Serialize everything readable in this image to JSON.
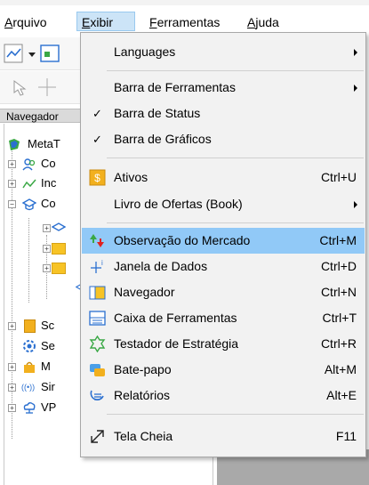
{
  "menubar": {
    "items": [
      {
        "label": "Arquivo",
        "accel": "A",
        "rest": "rquivo"
      },
      {
        "label": "Exibir",
        "accel": "E",
        "rest": "xibir"
      },
      {
        "label": "Ferramentas",
        "accel": "F",
        "rest": "erramentas"
      },
      {
        "label": "Ajuda",
        "accel": "A",
        "rest": "juda"
      }
    ]
  },
  "navigator": {
    "header": "Navegador",
    "root_label": "MetaT",
    "rows": [
      {
        "label": "Co",
        "icon": "accounts-icon"
      },
      {
        "label": "Inc",
        "icon": "indicators-icon"
      },
      {
        "label": "Co",
        "icon": "experts-icon"
      },
      {
        "label": "",
        "icon": "sub-item-icon"
      },
      {
        "label": "",
        "icon": "folder-icon"
      },
      {
        "label": "",
        "icon": "folder-icon"
      },
      {
        "label": "",
        "icon": "sub-item-icon"
      },
      {
        "label": "Sc",
        "icon": "scripts-icon"
      },
      {
        "label": "Se",
        "icon": "services-icon"
      },
      {
        "label": "M",
        "icon": "market-icon"
      },
      {
        "label": "Sir",
        "icon": "signals-icon"
      },
      {
        "label": "VP",
        "icon": "vps-icon"
      }
    ]
  },
  "dropdown": {
    "items": [
      {
        "label": "Languages",
        "shortcut": "",
        "submenu": true,
        "check": false,
        "icon": ""
      },
      {
        "label": "Barra de Ferramentas",
        "shortcut": "",
        "submenu": true,
        "check": false,
        "icon": ""
      },
      {
        "label": "Barra de Status",
        "shortcut": "",
        "submenu": false,
        "check": true,
        "icon": ""
      },
      {
        "label": "Barra de Gráficos",
        "shortcut": "",
        "submenu": false,
        "check": true,
        "icon": ""
      },
      {
        "label": "Ativos",
        "shortcut": "Ctrl+U",
        "submenu": false,
        "check": false,
        "icon": "symbols-icon"
      },
      {
        "label": "Livro de Ofertas (Book)",
        "shortcut": "",
        "submenu": true,
        "check": false,
        "icon": ""
      },
      {
        "label": "Observação do Mercado",
        "shortcut": "Ctrl+M",
        "submenu": false,
        "check": false,
        "icon": "market-watch-icon",
        "highlight": true
      },
      {
        "label": "Janela de Dados",
        "shortcut": "Ctrl+D",
        "submenu": false,
        "check": false,
        "icon": "data-window-icon"
      },
      {
        "label": "Navegador",
        "shortcut": "Ctrl+N",
        "submenu": false,
        "check": false,
        "icon": "navigator-icon"
      },
      {
        "label": "Caixa de Ferramentas",
        "shortcut": "Ctrl+T",
        "submenu": false,
        "check": false,
        "icon": "toolbox-icon"
      },
      {
        "label": "Testador de Estratégia",
        "shortcut": "Ctrl+R",
        "submenu": false,
        "check": false,
        "icon": "strategy-tester-icon"
      },
      {
        "label": "Bate-papo",
        "shortcut": "Alt+M",
        "submenu": false,
        "check": false,
        "icon": "chat-icon"
      },
      {
        "label": "Relatórios",
        "shortcut": "Alt+E",
        "submenu": false,
        "check": false,
        "icon": "reports-icon"
      },
      {
        "label": "Tela Cheia",
        "shortcut": "F11",
        "submenu": false,
        "check": false,
        "icon": "fullscreen-icon"
      }
    ],
    "check_glyph": "✓"
  },
  "colors": {
    "highlight": "#91c9f7",
    "menu_active": "#cce4f7",
    "menu_bg": "#f2f2f2"
  }
}
